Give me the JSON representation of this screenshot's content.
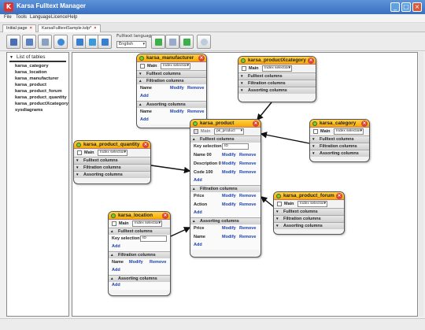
{
  "window": {
    "title": "Karsa Fulltext Manager"
  },
  "menu": [
    "File",
    "Tools",
    "Language",
    "Licence",
    "Help"
  ],
  "tabs": [
    {
      "label": "Initial page"
    },
    {
      "label": "KarsaFulltextSample.kdp*"
    }
  ],
  "toolbar": {
    "language_label": "Fulltext language",
    "language_value": "English"
  },
  "left_panel": {
    "title": "List of tables",
    "items": [
      "karsa_category",
      "karsa_location",
      "karsa_manufacturer",
      "karsa_product",
      "karsa_product_forum",
      "karsa_product_quantity",
      "karsa_productXcategory",
      "sysdiagrams"
    ]
  },
  "labels": {
    "main": "Main",
    "index_selection": "Index selection",
    "fulltext": "Fulltext columns",
    "filtration": "Filtration columns",
    "assorting": "Assorting columns",
    "add": "Add",
    "modify": "Modify",
    "remove": "Remove",
    "key_selection": "Key selection"
  },
  "cards": {
    "manufacturer": {
      "name": "karsa_manufacturer",
      "filt_row": "Name",
      "assort_row": "Name"
    },
    "productx": {
      "name": "karsa_productXcategory"
    },
    "product": {
      "name": "karsa_product",
      "index_value": "pk_product",
      "key_value": "ID",
      "fulltext_rows": [
        "Name 00",
        "Description 0",
        "Code 100"
      ],
      "filtration_rows": [
        "Price",
        "Action"
      ],
      "assorting_rows": [
        "Price",
        "Name"
      ]
    },
    "category": {
      "name": "karsa_category"
    },
    "quantity": {
      "name": "karsa_product_quantity"
    },
    "forum": {
      "name": "karsa_product_forum"
    },
    "location": {
      "name": "karsa_location",
      "key_value": "ID",
      "filt_row": "Name"
    }
  }
}
